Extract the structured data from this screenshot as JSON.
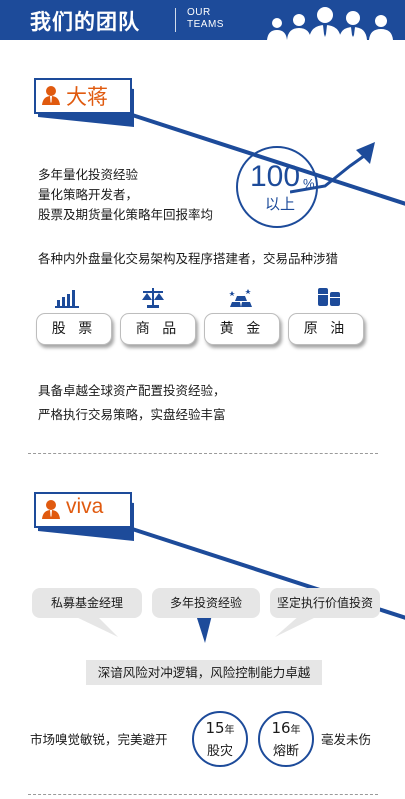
{
  "header": {
    "title": "我们的团队",
    "subtitle_line1": "OUR",
    "subtitle_line2": "TEAMS",
    "icon": "team-silhouette-icon"
  },
  "colors": {
    "brand_blue": "#1d4b9a",
    "name_orange": "#e05a0f",
    "bubble_gray": "#e6e6e6"
  },
  "member1": {
    "name": "大蒋",
    "lines": [
      "多年量化投资经验",
      "量化策略开发者，",
      "股票及期货量化策略年回报率均"
    ],
    "badge_value": "100",
    "badge_unit": "%",
    "badge_suffix": "以上",
    "arch_text": "各种内外盘量化交易架构及程序搭建者，交易品种涉猎",
    "assets": [
      {
        "label": "股 票",
        "icon": "bar-chart-icon"
      },
      {
        "label": "商 品",
        "icon": "scale-icon"
      },
      {
        "label": "黄 金",
        "icon": "gold-bars-icon"
      },
      {
        "label": "原 油",
        "icon": "oil-barrels-icon"
      }
    ],
    "summary_lines": [
      "具备卓越全球资产配置投资经验，",
      "严格执行交易策略，实盘经验丰富"
    ]
  },
  "member2": {
    "name": "viva",
    "bubbles": [
      "私募基金经理",
      "多年投资经验",
      "坚定执行价值投资"
    ],
    "center": "深谙风险对冲逻辑，风险控制能力卓越",
    "market_left": "市场嗅觉敏锐，完美避开",
    "ring1": {
      "num": "15",
      "unit": "年",
      "word": "股灾"
    },
    "ring2": {
      "num": "16",
      "unit": "年",
      "word": "熔断"
    },
    "market_right": "毫发未伤"
  }
}
